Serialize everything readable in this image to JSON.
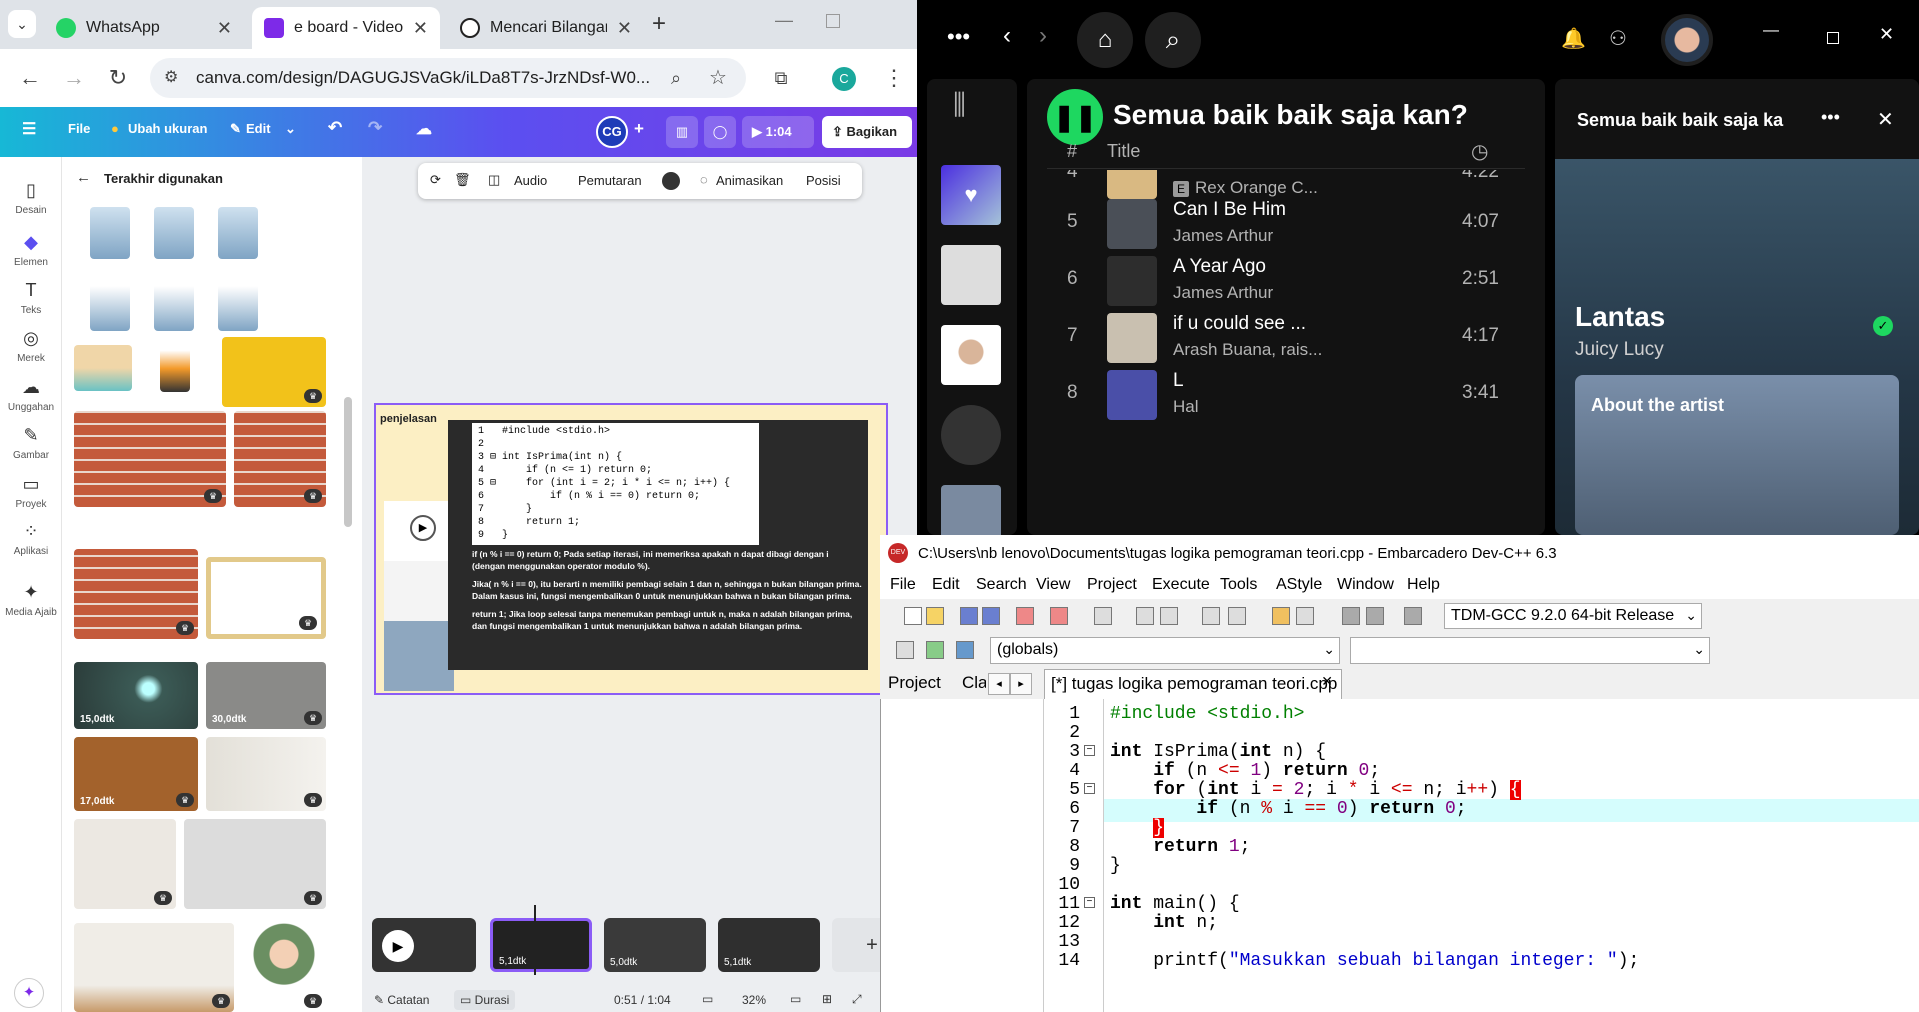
{
  "chrome": {
    "tabs": [
      {
        "title": "WhatsApp",
        "fav_color": "#25d366"
      },
      {
        "title": "e board - Video",
        "fav_color": "#7d2ae8"
      },
      {
        "title": "Mencari Bilangan",
        "fav_color": "#222222"
      }
    ],
    "new_tab": "+",
    "url": "canva.com/design/DAGUGJSVaGk/iLDa8T7s-JrzNDsf-W0...",
    "profile": "C"
  },
  "canva": {
    "header": {
      "file": "File",
      "resize": "Ubah ukuran",
      "edit": "Edit",
      "avatar": "CG",
      "timer": "1:04",
      "share": "Bagikan"
    },
    "rail": [
      {
        "label": "Desain",
        "icon": "▯"
      },
      {
        "label": "Elemen",
        "icon": "◆"
      },
      {
        "label": "Teks",
        "icon": "T"
      },
      {
        "label": "Merek",
        "icon": "◎"
      },
      {
        "label": "Unggahan",
        "icon": "☁"
      },
      {
        "label": "Gambar",
        "icon": "✎"
      },
      {
        "label": "Proyek",
        "icon": "▭"
      },
      {
        "label": "Aplikasi",
        "icon": "⁘"
      },
      {
        "label": "Media Ajaib",
        "icon": "✦"
      }
    ],
    "panel_title": "Terakhir digunakan",
    "durations": [
      "15,0dtk",
      "30,0dtk",
      "17,0dtk"
    ],
    "toolbar": {
      "audio": "Audio",
      "playback": "Pemutaran",
      "animate": "Animasikan",
      "position": "Posisi"
    },
    "slide": {
      "heading": "penjelasan",
      "code": "1   #include <stdio.h>\n2\n3 ⊟ int IsPrima(int n) {\n4       if (n <= 1) return 0;\n5 ⊟     for (int i = 2; i * i <= n; i++) {\n6           if (n % i == 0) return 0;\n7       }\n8       return 1;\n9   }",
      "explanation": [
        "if (n % i == 0) return 0; Pada setiap iterasi, ini memeriksa apakah n dapat dibagi dengan i (dengan menggunakan operator modulo %).",
        "Jika( n % i == 0), itu berarti n memiliki pembagi selain 1 dan n, sehingga n bukan bilangan prima. Dalam kasus ini, fungsi mengembalikan 0 untuk menunjukkan bahwa n bukan bilangan prima.",
        "return 1; Jika loop selesai tanpa menemukan pembagi untuk n, maka n adalah bilangan prima, dan fungsi mengembalikan 1 untuk menunjukkan bahwa n adalah bilangan prima."
      ]
    },
    "timeline": {
      "clips": [
        "5,1dtk",
        "5,0dtk",
        "5,1dtk"
      ]
    },
    "status": {
      "notes": "Catatan",
      "duration": "Durasi",
      "time": "0:51 / 1:04",
      "zoom": "32%"
    }
  },
  "spotify": {
    "playlist_title": "Semua baik baik saja kan?",
    "col_title": "Title",
    "col_num": "#",
    "rows": [
      {
        "num": "4",
        "title": "",
        "artist": "Rex Orange C...",
        "time": "4:22",
        "explicit": "E"
      },
      {
        "num": "5",
        "title": "Can I Be Him",
        "artist": "James Arthur",
        "time": "4:07"
      },
      {
        "num": "6",
        "title": "A Year Ago",
        "artist": "James Arthur",
        "time": "2:51"
      },
      {
        "num": "7",
        "title": "if u could see ...",
        "artist": "Arash Buana, rais...",
        "time": "4:17"
      },
      {
        "num": "8",
        "title": "L",
        "artist": "Hal",
        "time": "3:41"
      }
    ],
    "right_title": "Semua baik baik saja ka",
    "now_song": "Lantas",
    "now_artist": "Juicy Lucy",
    "about": "About the artist"
  },
  "devcpp": {
    "title": "C:\\Users\\nb lenovo\\Documents\\tugas logika pemograman teori.cpp - Embarcadero Dev-C++ 6.3",
    "menu": [
      "File",
      "Edit",
      "Search",
      "View",
      "Project",
      "Execute",
      "Tools",
      "AStyle",
      "Window",
      "Help"
    ],
    "compiler": "TDM-GCC 9.2.0 64-bit Release",
    "scope": "(globals)",
    "left_tabs": [
      "Project",
      "Clas"
    ],
    "file_tab": "[*] tugas logika pemograman teori.cpp",
    "line_numbers": [
      "1",
      "2",
      "3",
      "4",
      "5",
      "6",
      "7",
      "8",
      "9",
      "10",
      "11",
      "12",
      "13",
      "14"
    ]
  }
}
